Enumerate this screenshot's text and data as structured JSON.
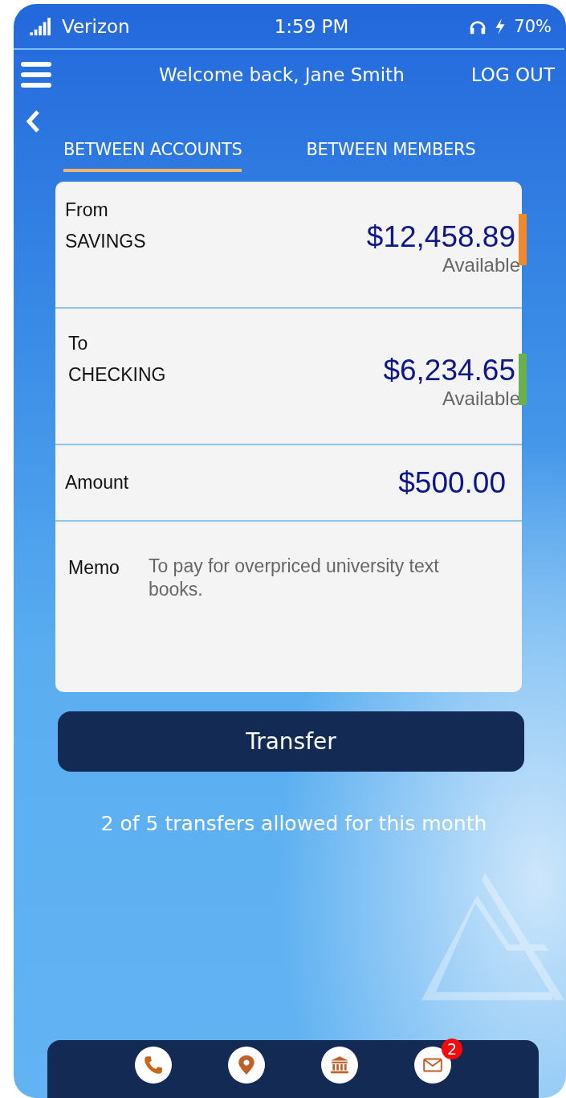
{
  "status_bar": {
    "carrier": "Verizon",
    "time": "1:59 PM",
    "battery": "70%"
  },
  "header": {
    "welcome": "Welcome back, Jane Smith",
    "logout": "LOG OUT"
  },
  "tabs": [
    {
      "label": "BETWEEN ACCOUNTS",
      "selected": true
    },
    {
      "label": "BETWEEN MEMBERS",
      "selected": false
    }
  ],
  "transfer_form": {
    "accounts": [
      {
        "label": "From",
        "name": "SAVINGS",
        "balance": "$12,458.89",
        "note": "Available",
        "color": "#f0882e"
      },
      {
        "label": "To",
        "name": "CHECKING",
        "balance": "$6,234.65",
        "note": "Available",
        "color": "#6ab04c"
      }
    ],
    "amount": {
      "label": "Amount",
      "value": "$500.00"
    },
    "memo": {
      "label": "Memo",
      "value": "To pay for overpriced university text books."
    }
  },
  "transfer_button": "Transfer",
  "limit_note": "2 of 5 transfers allowed for this month",
  "bottom_nav": [
    {
      "kind": "phone"
    },
    {
      "kind": "location"
    },
    {
      "kind": "bank"
    },
    {
      "kind": "mail",
      "badge": "2"
    }
  ]
}
